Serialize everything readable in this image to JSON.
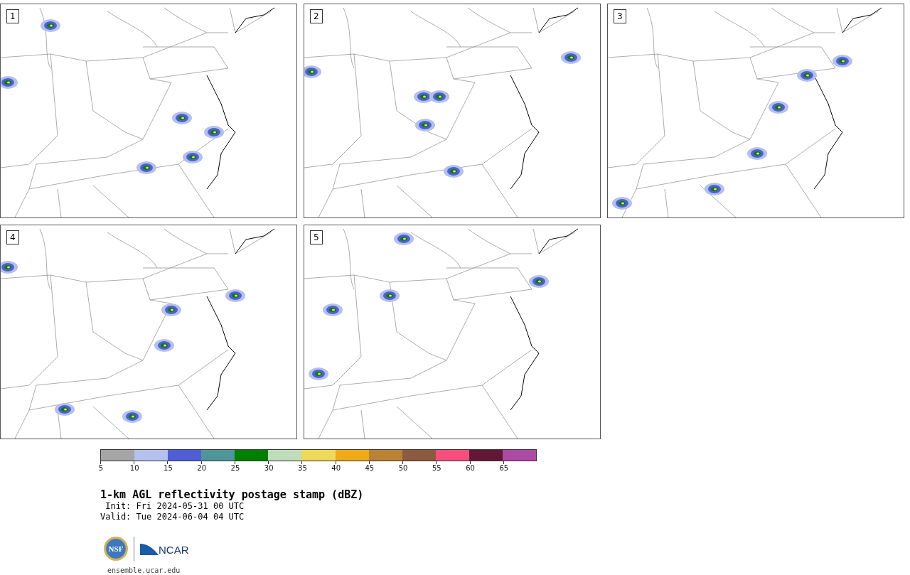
{
  "panels": [
    {
      "label": "1"
    },
    {
      "label": "2"
    },
    {
      "label": "3"
    },
    {
      "label": "4"
    },
    {
      "label": "5"
    }
  ],
  "colorbar": {
    "segments": [
      {
        "color": "#a5a5a5"
      },
      {
        "color": "#b4c0ed"
      },
      {
        "color": "#505ed6"
      },
      {
        "color": "#50959b"
      },
      {
        "color": "#008000"
      },
      {
        "color": "#bfdcbb"
      },
      {
        "color": "#eed95a"
      },
      {
        "color": "#efaa18"
      },
      {
        "color": "#bb8134"
      },
      {
        "color": "#8c5b3f"
      },
      {
        "color": "#f64f7e"
      },
      {
        "color": "#621734"
      },
      {
        "color": "#ad4aa5"
      }
    ],
    "ticks": [
      "5",
      "10",
      "15",
      "20",
      "25",
      "30",
      "35",
      "40",
      "45",
      "50",
      "55",
      "60",
      "65"
    ]
  },
  "title": "1-km AGL reflectivity postage stamp (dBZ)",
  "init": " Init: Fri 2024-05-31 00 UTC",
  "valid": "Valid: Tue 2024-06-04 04 UTC",
  "logo": {
    "nsf": "NSF",
    "ncar": "NCAR"
  },
  "footer": "ensemble.ucar.edu"
}
